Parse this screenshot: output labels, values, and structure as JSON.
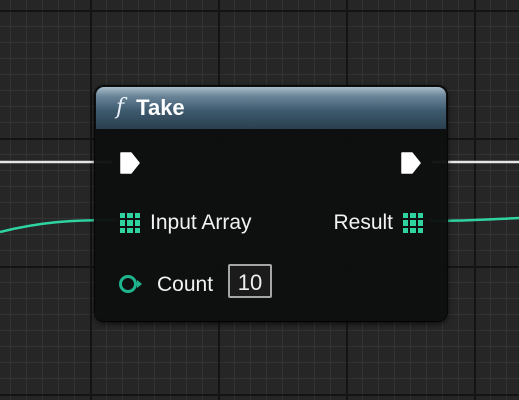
{
  "node": {
    "title": "Take",
    "function_icon": "f",
    "header_color": "#3f5b6f"
  },
  "pins": {
    "input_array_label": "Input Array",
    "result_label": "Result",
    "count_label": "Count",
    "count_value": "10"
  },
  "icons": {
    "function": "function-icon",
    "exec_in": "exec-in-pin-icon",
    "exec_out": "exec-out-pin-icon",
    "array_in": "array-in-pin-icon",
    "array_out": "array-out-pin-icon",
    "count_in": "integer-pin-icon"
  },
  "colors": {
    "array_pin": "#2fd3a0",
    "exec_pin": "#ffffff",
    "integer_pin": "#1fb48e",
    "graph_background": "#262626"
  }
}
